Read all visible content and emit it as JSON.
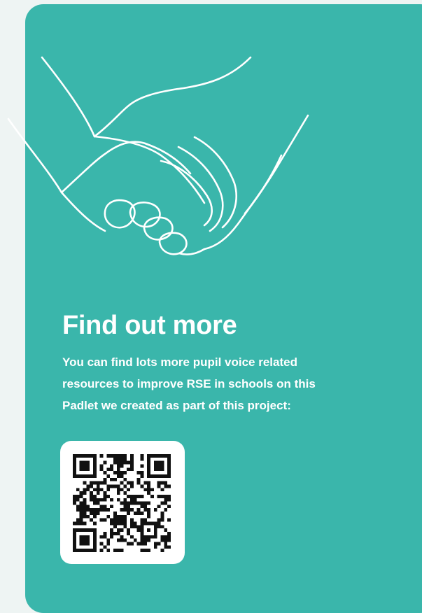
{
  "heading": "Find out more",
  "body_lines": [
    "You can find lots more pupil voice related",
    "resources to improve RSE in schools on this",
    "Padlet we created as part of this project:"
  ],
  "illustration": "holding-hands-line-art",
  "icons": {
    "qr": "qr-code-icon"
  },
  "colors": {
    "background": "#eef4f3",
    "card": "#3ab6ab",
    "text": "#ffffff",
    "qr_box": "#ffffff",
    "qr_modules": "#111111"
  }
}
